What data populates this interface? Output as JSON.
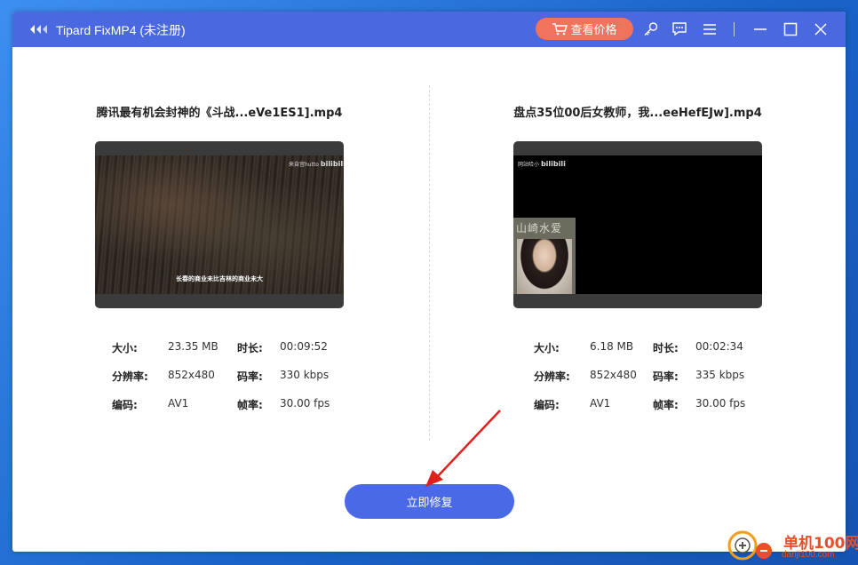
{
  "window": {
    "title": "Tipard FixMP4 (未注册)",
    "price_button": "查看价格"
  },
  "titlebar_icons": [
    "cart-icon",
    "key-icon",
    "feedback-icon",
    "menu-icon",
    "minimize-icon",
    "maximize-icon",
    "close-icon"
  ],
  "videos": [
    {
      "filename": "腾讯最有机会封神的《斗战...eVe1ES1].mp4",
      "watermark": "来自宫hutto",
      "watermark_brand": "bilibili",
      "subtitle": "长春的商业未比吉林的商业未大",
      "size_label": "大小:",
      "size": "23.35 MB",
      "duration_label": "时长:",
      "duration": "00:09:52",
      "resolution_label": "分辨率:",
      "resolution": "852x480",
      "bitrate_label": "码率:",
      "bitrate": "330 kbps",
      "codec_label": "编码:",
      "codec": "AV1",
      "fps_label": "帧率:",
      "fps": "30.00 fps"
    },
    {
      "filename": "盘点35位00后女教师，我...eeHefEJw].mp4",
      "watermark": "网站哈小",
      "watermark_brand": "bilibili",
      "inset_label": "山崎水爱",
      "size_label": "大小:",
      "size": "6.18 MB",
      "duration_label": "时长:",
      "duration": "00:02:34",
      "resolution_label": "分辨率:",
      "resolution": "852x480",
      "bitrate_label": "码率:",
      "bitrate": "335 kbps",
      "codec_label": "编码:",
      "codec": "AV1",
      "fps_label": "帧率:",
      "fps": "30.00 fps"
    }
  ],
  "repair_button": "立即修复",
  "site_watermark": {
    "name": "单机100网",
    "url": "danji100.com"
  },
  "colors": {
    "titlebar": "#4a69e0",
    "price_button": "#f2735b",
    "repair_button": "#4969e6",
    "arrow": "#e0201d"
  }
}
